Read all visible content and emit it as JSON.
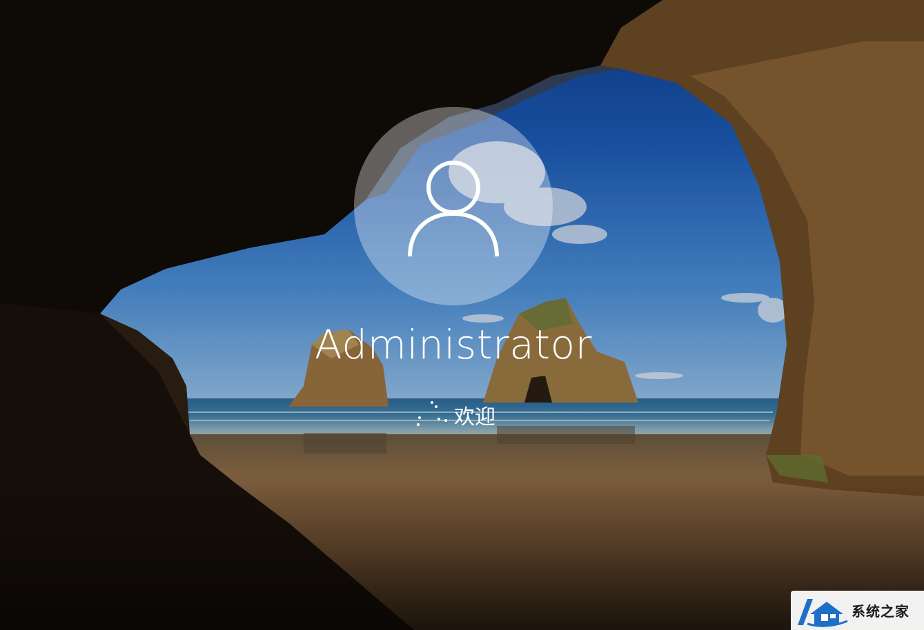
{
  "login": {
    "username": "Administrator",
    "status_text": "欢迎",
    "avatar_icon": "user-icon",
    "spinner_icon": "loading-dots-icon"
  },
  "wallpaper": {
    "scene": "sea-cave-beach"
  },
  "watermark": {
    "text": "系统之家",
    "icon": "house-logo-icon"
  },
  "colors": {
    "text": "#ffffff",
    "avatar_circle": "rgba(255,255,255,0.35)"
  }
}
